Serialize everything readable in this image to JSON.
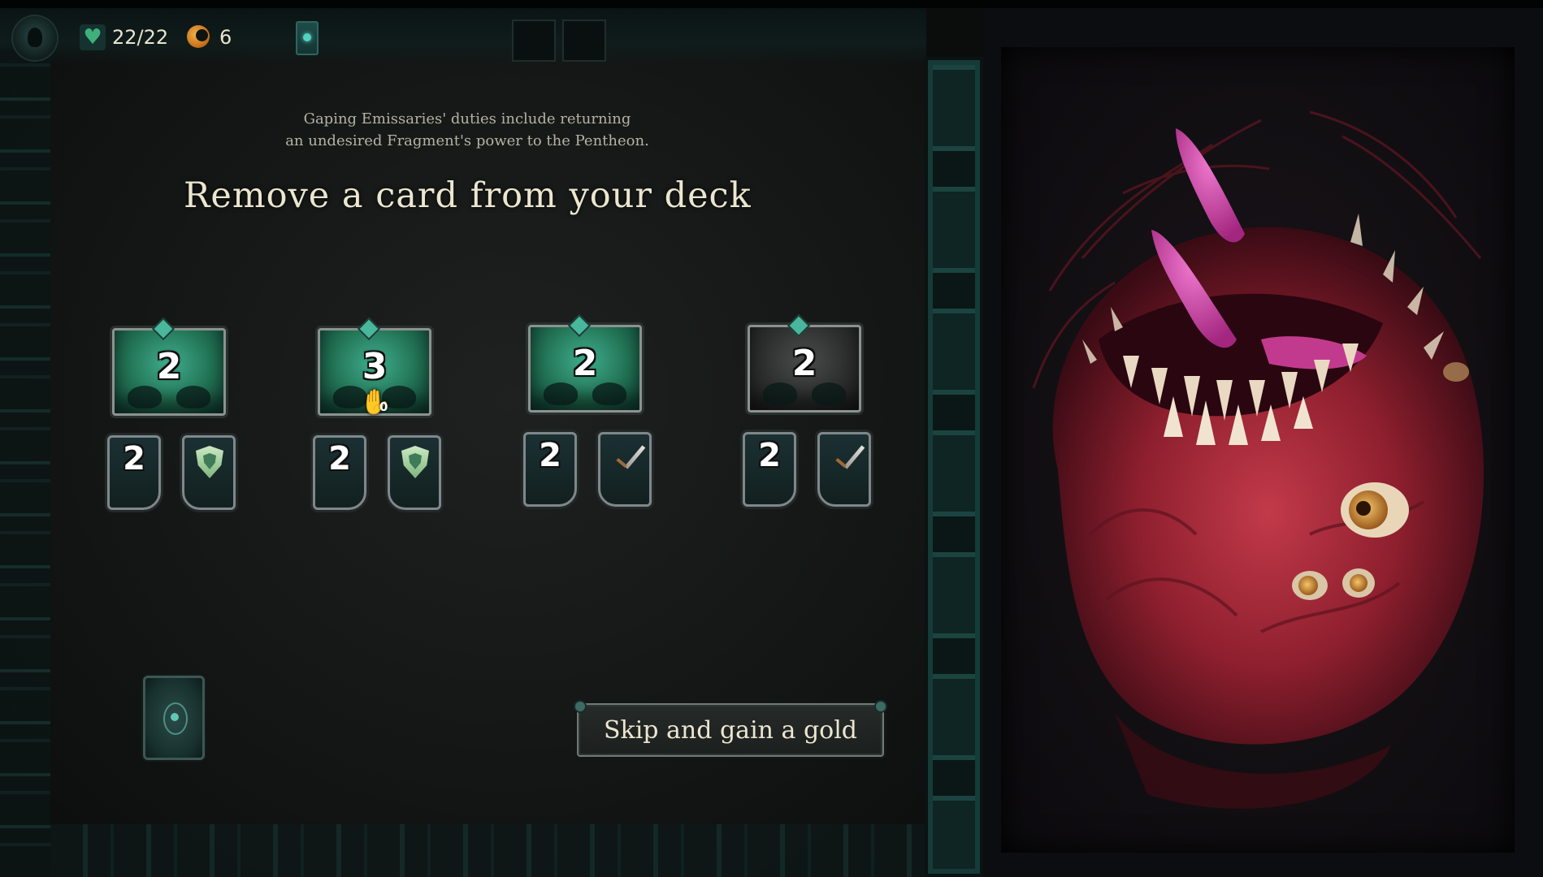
{
  "hud": {
    "health": "22/22",
    "gold": "6"
  },
  "event": {
    "flavor_line1": "Gaping Emissaries' duties include returning",
    "flavor_line2": "an undesired Fragment's power to the Pentheon.",
    "title": "Remove a card from your deck"
  },
  "cards": [
    {
      "cost": "2",
      "bottom_value": "2",
      "effect_icon": "shield-icon",
      "art": "green"
    },
    {
      "cost": "3",
      "bottom_value": "2",
      "effect_icon": "shield-icon",
      "art": "green",
      "hand_count": "0"
    },
    {
      "cost": "2",
      "bottom_value": "2",
      "effect_icon": "sword-icon",
      "art": "green"
    },
    {
      "cost": "2",
      "bottom_value": "2",
      "effect_icon": "sword-icon",
      "art": "grey"
    }
  ],
  "skip_button": {
    "label": "Skip and gain a gold"
  },
  "colors": {
    "accent_teal": "#48b79b",
    "monster_red": "#b3243a",
    "tongue_pink": "#e04aa8",
    "text_cream": "#ece6cf"
  }
}
